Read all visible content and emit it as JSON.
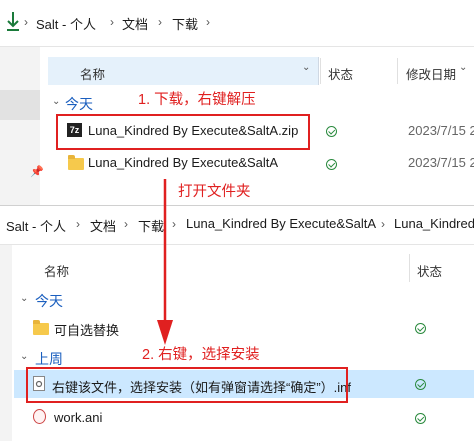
{
  "top_window": {
    "breadcrumbs": [
      "Salt - 个人",
      "文档",
      "下载"
    ],
    "columns": {
      "name": "名称",
      "status": "状态",
      "modified": "修改日期"
    },
    "group_today": "今天",
    "rows": [
      {
        "name": "Luna_Kindred By Execute&SaltA.zip",
        "date": "2023/7/15 2"
      },
      {
        "name": "Luna_Kindred By Execute&SaltA",
        "date": "2023/7/15 2"
      }
    ]
  },
  "annotations": {
    "step1": "1. 下载，右键解压",
    "open_folder": "打开文件夹",
    "step2": "2. 右键，选择安装",
    "accent_color": "#e02020"
  },
  "bottom_window": {
    "breadcrumbs": [
      "Salt - 个人",
      "文档",
      "下载",
      "Luna_Kindred By Execute&SaltA",
      "Luna_Kindred"
    ],
    "columns": {
      "name": "名称",
      "status": "状态"
    },
    "group_today": "今天",
    "group_last_week": "上周",
    "rows": [
      {
        "name": "可自选替换"
      },
      {
        "name": "右键该文件，选择安装（如有弹窗请选择“确定”）.inf"
      },
      {
        "name": "work.ani"
      }
    ]
  }
}
